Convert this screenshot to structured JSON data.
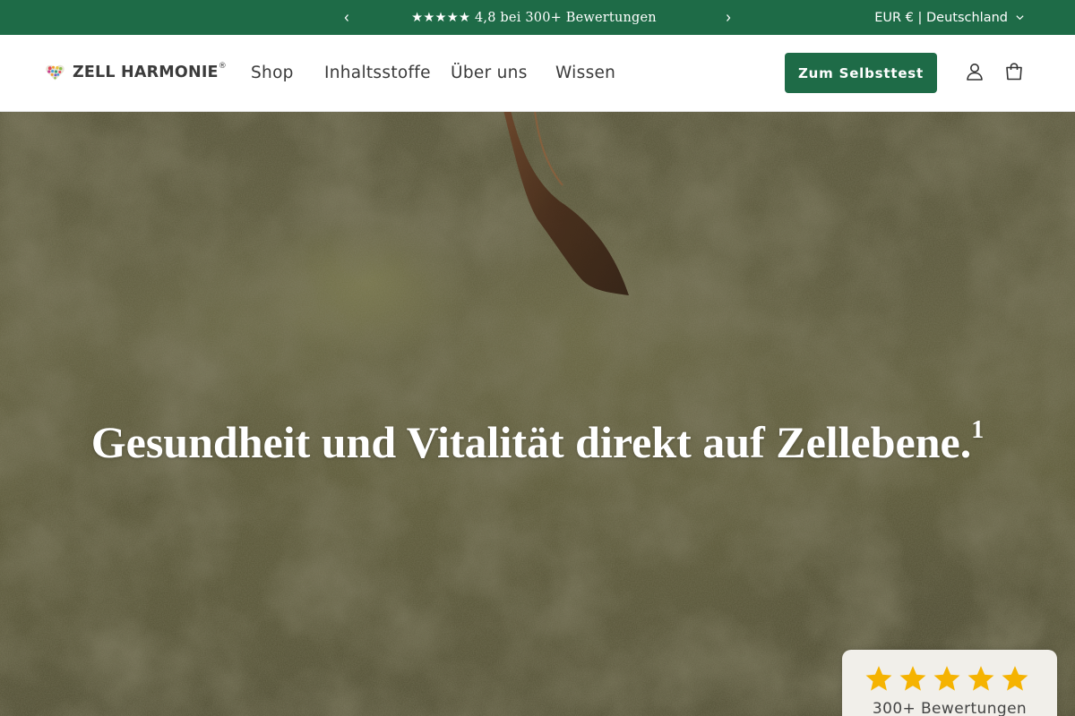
{
  "announcement": {
    "message": "★★★★★ 4,8 bei 300+ Bewertungen",
    "prev_icon": "chevron-left-icon",
    "next_icon": "chevron-right-icon"
  },
  "locale": {
    "label": "EUR € | Deutschland",
    "icon": "chevron-down-icon"
  },
  "header": {
    "logo_text": "ZELL HARMONIE",
    "logo_mark": "®",
    "nav": [
      {
        "label": "Shop"
      },
      {
        "label": "Inhaltsstoffe"
      },
      {
        "label": "Über uns"
      },
      {
        "label": "Wissen"
      }
    ],
    "cta_label": "Zum Selbsttest",
    "account_icon": "user-icon",
    "cart_icon": "cart-icon"
  },
  "hero": {
    "title": "Gesundheit und Vitalität direkt auf Zellebene.",
    "footnote": "1"
  },
  "reviews": {
    "count_label": "300+ Bewertungen",
    "stars": 5,
    "star_color": "#f5b301"
  },
  "colors": {
    "brand_green": "#1e6b47",
    "header_text": "#3a3a3a"
  }
}
